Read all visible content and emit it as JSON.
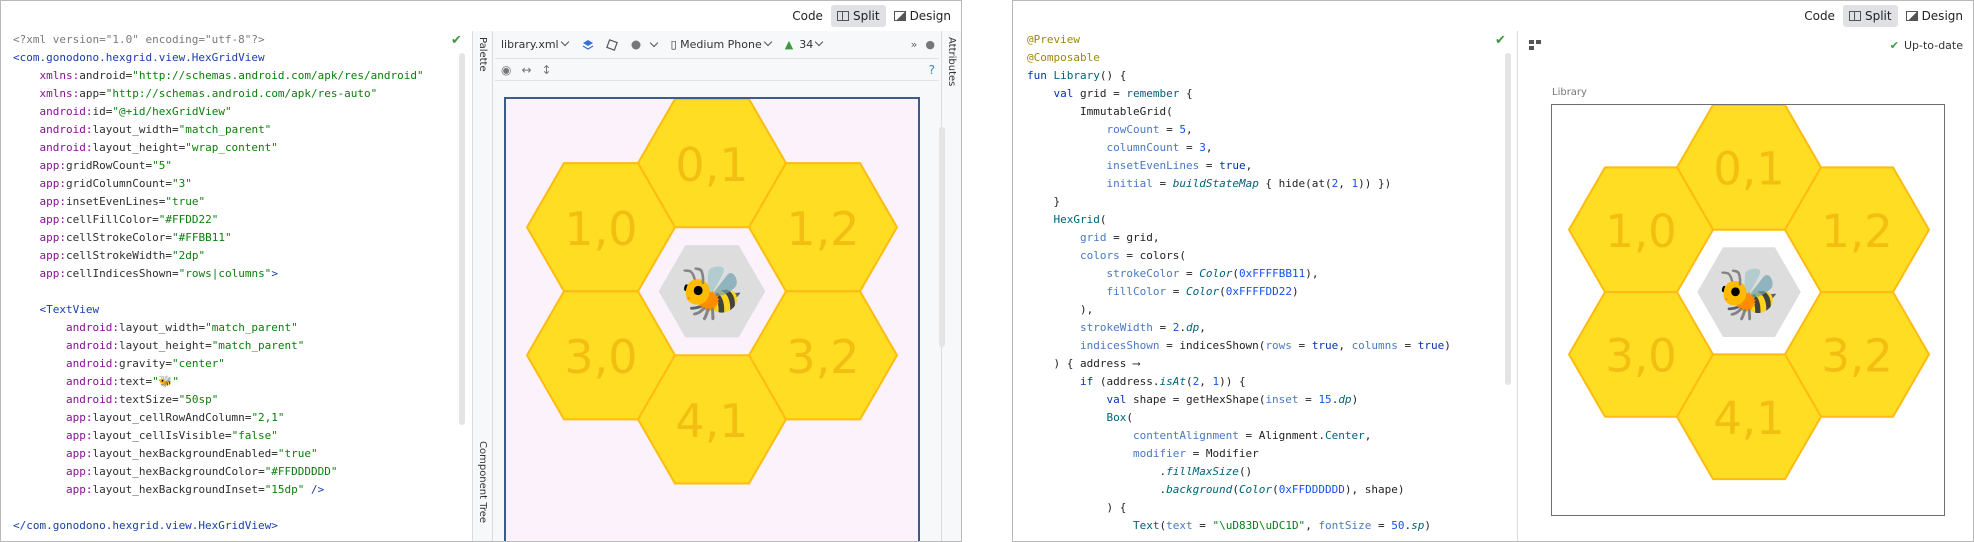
{
  "modes": {
    "code": "Code",
    "split": "Split",
    "design": "Design",
    "active": "Split"
  },
  "xml_lines": [
    [
      [
        "x-dec",
        "<?xml version=\"1.0\" encoding=\"utf-8\"?>"
      ]
    ],
    [
      [
        "x-tag",
        "<com.gonodono.hexgrid.view.HexGridView"
      ]
    ],
    [
      [
        "x-attr",
        "    "
      ],
      [
        "x-ans",
        "xmlns:"
      ],
      [
        "x-attr",
        "android"
      ],
      [
        "x-eq",
        "="
      ],
      [
        "x-val",
        "\"http://schemas.android.com/apk/res/android\""
      ]
    ],
    [
      [
        "x-attr",
        "    "
      ],
      [
        "x-ans",
        "xmlns:"
      ],
      [
        "x-attr",
        "app"
      ],
      [
        "x-eq",
        "="
      ],
      [
        "x-val",
        "\"http://schemas.android.com/apk/res-auto\""
      ]
    ],
    [
      [
        "x-attr",
        "    "
      ],
      [
        "x-ans",
        "android:"
      ],
      [
        "x-attr",
        "id"
      ],
      [
        "x-eq",
        "="
      ],
      [
        "x-val",
        "\"@+id/hexGridView\""
      ]
    ],
    [
      [
        "x-attr",
        "    "
      ],
      [
        "x-ans",
        "android:"
      ],
      [
        "x-attr",
        "layout_width"
      ],
      [
        "x-eq",
        "="
      ],
      [
        "x-val",
        "\"match_parent\""
      ]
    ],
    [
      [
        "x-attr",
        "    "
      ],
      [
        "x-ans",
        "android:"
      ],
      [
        "x-attr",
        "layout_height"
      ],
      [
        "x-eq",
        "="
      ],
      [
        "x-val",
        "\"wrap_content\""
      ]
    ],
    [
      [
        "x-attr",
        "    "
      ],
      [
        "x-ans",
        "app:"
      ],
      [
        "x-attr",
        "gridRowCount"
      ],
      [
        "x-eq",
        "="
      ],
      [
        "x-val",
        "\"5\""
      ]
    ],
    [
      [
        "x-attr",
        "    "
      ],
      [
        "x-ans",
        "app:"
      ],
      [
        "x-attr",
        "gridColumnCount"
      ],
      [
        "x-eq",
        "="
      ],
      [
        "x-val",
        "\"3\""
      ]
    ],
    [
      [
        "x-attr",
        "    "
      ],
      [
        "x-ans",
        "app:"
      ],
      [
        "x-attr",
        "insetEvenLines"
      ],
      [
        "x-eq",
        "="
      ],
      [
        "x-val",
        "\"true\""
      ]
    ],
    [
      [
        "x-attr",
        "    "
      ],
      [
        "x-ans",
        "app:"
      ],
      [
        "x-attr",
        "cellFillColor"
      ],
      [
        "x-eq",
        "="
      ],
      [
        "x-val",
        "\"#FFDD22\""
      ]
    ],
    [
      [
        "x-attr",
        "    "
      ],
      [
        "x-ans",
        "app:"
      ],
      [
        "x-attr",
        "cellStrokeColor"
      ],
      [
        "x-eq",
        "="
      ],
      [
        "x-val",
        "\"#FFBB11\""
      ]
    ],
    [
      [
        "x-attr",
        "    "
      ],
      [
        "x-ans",
        "app:"
      ],
      [
        "x-attr",
        "cellStrokeWidth"
      ],
      [
        "x-eq",
        "="
      ],
      [
        "x-val",
        "\"2dp\""
      ]
    ],
    [
      [
        "x-attr",
        "    "
      ],
      [
        "x-ans",
        "app:"
      ],
      [
        "x-attr",
        "cellIndicesShown"
      ],
      [
        "x-eq",
        "="
      ],
      [
        "x-val",
        "\"rows|columns\""
      ],
      [
        "x-tag",
        ">"
      ]
    ],
    [
      [
        "x-attr",
        " "
      ]
    ],
    [
      [
        "x-attr",
        "    "
      ],
      [
        "x-tag",
        "<TextView"
      ]
    ],
    [
      [
        "x-attr",
        "        "
      ],
      [
        "x-ans",
        "android:"
      ],
      [
        "x-attr",
        "layout_width"
      ],
      [
        "x-eq",
        "="
      ],
      [
        "x-val",
        "\"match_parent\""
      ]
    ],
    [
      [
        "x-attr",
        "        "
      ],
      [
        "x-ans",
        "android:"
      ],
      [
        "x-attr",
        "layout_height"
      ],
      [
        "x-eq",
        "="
      ],
      [
        "x-val",
        "\"match_parent\""
      ]
    ],
    [
      [
        "x-attr",
        "        "
      ],
      [
        "x-ans",
        "android:"
      ],
      [
        "x-attr",
        "gravity"
      ],
      [
        "x-eq",
        "="
      ],
      [
        "x-val",
        "\"center\""
      ]
    ],
    [
      [
        "x-attr",
        "        "
      ],
      [
        "x-ans",
        "android:"
      ],
      [
        "x-attr",
        "text"
      ],
      [
        "x-eq",
        "="
      ],
      [
        "x-val",
        "\"🐝\""
      ]
    ],
    [
      [
        "x-attr",
        "        "
      ],
      [
        "x-ans",
        "android:"
      ],
      [
        "x-attr",
        "textSize"
      ],
      [
        "x-eq",
        "="
      ],
      [
        "x-val",
        "\"50sp\""
      ]
    ],
    [
      [
        "x-attr",
        "        "
      ],
      [
        "x-ans",
        "app:"
      ],
      [
        "x-attr",
        "layout_cellRowAndColumn"
      ],
      [
        "x-eq",
        "="
      ],
      [
        "x-val",
        "\"2,1\""
      ]
    ],
    [
      [
        "x-attr",
        "        "
      ],
      [
        "x-ans",
        "app:"
      ],
      [
        "x-attr",
        "layout_cellIsVisible"
      ],
      [
        "x-eq",
        "="
      ],
      [
        "x-val",
        "\"false\""
      ]
    ],
    [
      [
        "x-attr",
        "        "
      ],
      [
        "x-ans",
        "app:"
      ],
      [
        "x-attr",
        "layout_hexBackgroundEnabled"
      ],
      [
        "x-eq",
        "="
      ],
      [
        "x-val",
        "\"true\""
      ]
    ],
    [
      [
        "x-attr",
        "        "
      ],
      [
        "x-ans",
        "app:"
      ],
      [
        "x-attr",
        "layout_hexBackgroundColor"
      ],
      [
        "x-eq",
        "="
      ],
      [
        "x-val",
        "\"#FFDDDDDD\""
      ]
    ],
    [
      [
        "x-attr",
        "        "
      ],
      [
        "x-ans",
        "app:"
      ],
      [
        "x-attr",
        "layout_hexBackgroundInset"
      ],
      [
        "x-eq",
        "="
      ],
      [
        "x-val",
        "\"15dp\""
      ],
      [
        "x-tag",
        " />"
      ]
    ],
    [
      [
        "x-attr",
        " "
      ]
    ],
    [
      [
        "x-tag",
        "</com.gonodono.hexgrid.view.HexGridView"
      ],
      [
        "x-tag",
        ">"
      ]
    ]
  ],
  "kt_lines": [
    [
      [
        "k-ann",
        "@Preview"
      ]
    ],
    [
      [
        "k-ann",
        "@Composable"
      ]
    ],
    [
      [
        "k-kw",
        "fun "
      ],
      [
        "k-fn",
        "Library"
      ],
      [
        "k-plain",
        "() {"
      ]
    ],
    [
      [
        "k-plain",
        "    "
      ],
      [
        "k-kw",
        "val "
      ],
      [
        "k-id",
        "grid = "
      ],
      [
        "k-fn",
        "remember"
      ],
      [
        "k-plain",
        " {"
      ]
    ],
    [
      [
        "k-plain",
        "        ImmutableGrid("
      ]
    ],
    [
      [
        "k-plain",
        "            "
      ],
      [
        "k-pn",
        "rowCount"
      ],
      [
        "k-plain",
        " = "
      ],
      [
        "k-num",
        "5"
      ],
      [
        "k-plain",
        ","
      ]
    ],
    [
      [
        "k-plain",
        "            "
      ],
      [
        "k-pn",
        "columnCount"
      ],
      [
        "k-plain",
        " = "
      ],
      [
        "k-num",
        "3"
      ],
      [
        "k-plain",
        ","
      ]
    ],
    [
      [
        "k-plain",
        "            "
      ],
      [
        "k-pn",
        "insetEvenLines"
      ],
      [
        "k-plain",
        " = "
      ],
      [
        "k-kw",
        "true"
      ],
      [
        "k-plain",
        ","
      ]
    ],
    [
      [
        "k-plain",
        "            "
      ],
      [
        "k-pn",
        "initial"
      ],
      [
        "k-plain",
        " = "
      ],
      [
        "k-it",
        "buildStateMap"
      ],
      [
        "k-plain",
        " { hide(at("
      ],
      [
        "k-num",
        "2"
      ],
      [
        "k-plain",
        ", "
      ],
      [
        "k-num",
        "1"
      ],
      [
        "k-plain",
        ")) })"
      ]
    ],
    [
      [
        "k-plain",
        "    }"
      ]
    ],
    [
      [
        "k-plain",
        "    "
      ],
      [
        "k-fn",
        "HexGrid"
      ],
      [
        "k-plain",
        "("
      ]
    ],
    [
      [
        "k-plain",
        "        "
      ],
      [
        "k-pn",
        "grid"
      ],
      [
        "k-plain",
        " = grid,"
      ]
    ],
    [
      [
        "k-plain",
        "        "
      ],
      [
        "k-pn",
        "colors"
      ],
      [
        "k-plain",
        " = colors("
      ]
    ],
    [
      [
        "k-plain",
        "            "
      ],
      [
        "k-pn",
        "strokeColor"
      ],
      [
        "k-plain",
        " = "
      ],
      [
        "k-it",
        "Color"
      ],
      [
        "k-plain",
        "("
      ],
      [
        "k-num",
        "0xFFFFBB11"
      ],
      [
        "k-plain",
        "),"
      ]
    ],
    [
      [
        "k-plain",
        "            "
      ],
      [
        "k-pn",
        "fillColor"
      ],
      [
        "k-plain",
        " = "
      ],
      [
        "k-it",
        "Color"
      ],
      [
        "k-plain",
        "("
      ],
      [
        "k-num",
        "0xFFFFDD22"
      ],
      [
        "k-plain",
        ")"
      ]
    ],
    [
      [
        "k-plain",
        "        ),"
      ]
    ],
    [
      [
        "k-plain",
        "        "
      ],
      [
        "k-pn",
        "strokeWidth"
      ],
      [
        "k-plain",
        " = "
      ],
      [
        "k-num",
        "2"
      ],
      [
        "k-plain",
        "."
      ],
      [
        "k-it",
        "dp"
      ],
      [
        "k-plain",
        ","
      ]
    ],
    [
      [
        "k-plain",
        "        "
      ],
      [
        "k-pn",
        "indicesShown"
      ],
      [
        "k-plain",
        " = indicesShown("
      ],
      [
        "k-pn",
        "rows"
      ],
      [
        "k-plain",
        " = "
      ],
      [
        "k-kw",
        "true"
      ],
      [
        "k-plain",
        ", "
      ],
      [
        "k-pn",
        "columns"
      ],
      [
        "k-plain",
        " = "
      ],
      [
        "k-kw",
        "true"
      ],
      [
        "k-plain",
        ")"
      ]
    ],
    [
      [
        "k-plain",
        "    ) { address ⟶"
      ]
    ],
    [
      [
        "k-plain",
        "        "
      ],
      [
        "k-kw",
        "if"
      ],
      [
        "k-plain",
        " (address."
      ],
      [
        "k-it",
        "isAt"
      ],
      [
        "k-plain",
        "("
      ],
      [
        "k-num",
        "2"
      ],
      [
        "k-plain",
        ", "
      ],
      [
        "k-num",
        "1"
      ],
      [
        "k-plain",
        ")) {"
      ]
    ],
    [
      [
        "k-plain",
        "            "
      ],
      [
        "k-kw",
        "val "
      ],
      [
        "k-plain",
        "shape = getHexShape("
      ],
      [
        "k-pn",
        "inset"
      ],
      [
        "k-plain",
        " = "
      ],
      [
        "k-num",
        "15"
      ],
      [
        "k-plain",
        "."
      ],
      [
        "k-it",
        "dp"
      ],
      [
        "k-plain",
        ")"
      ]
    ],
    [
      [
        "k-plain",
        "            "
      ],
      [
        "k-fn",
        "Box"
      ],
      [
        "k-plain",
        "("
      ]
    ],
    [
      [
        "k-plain",
        "                "
      ],
      [
        "k-pn",
        "contentAlignment"
      ],
      [
        "k-plain",
        " = Alignment."
      ],
      [
        "k-fn",
        "Center"
      ],
      [
        "k-plain",
        ","
      ]
    ],
    [
      [
        "k-plain",
        "                "
      ],
      [
        "k-pn",
        "modifier"
      ],
      [
        "k-plain",
        " = Modifier"
      ]
    ],
    [
      [
        "k-plain",
        "                    ."
      ],
      [
        "k-it",
        "fillMaxSize"
      ],
      [
        "k-plain",
        "()"
      ]
    ],
    [
      [
        "k-plain",
        "                    ."
      ],
      [
        "k-it",
        "background"
      ],
      [
        "k-plain",
        "("
      ],
      [
        "k-it",
        "Color"
      ],
      [
        "k-plain",
        "("
      ],
      [
        "k-num",
        "0xFFDDDDDD"
      ],
      [
        "k-plain",
        "), shape)"
      ]
    ],
    [
      [
        "k-plain",
        "            ) {"
      ]
    ],
    [
      [
        "k-plain",
        "                "
      ],
      [
        "k-fn",
        "Text"
      ],
      [
        "k-plain",
        "("
      ],
      [
        "k-pn",
        "text"
      ],
      [
        "k-plain",
        " = "
      ],
      [
        "k-str",
        "\"\\uD83D\\uDC1D\""
      ],
      [
        "k-plain",
        ", "
      ],
      [
        "k-pn",
        "fontSize"
      ],
      [
        "k-plain",
        " = "
      ],
      [
        "k-num",
        "50"
      ],
      [
        "k-plain",
        "."
      ],
      [
        "k-it",
        "sp"
      ],
      [
        "k-plain",
        ")"
      ]
    ]
  ],
  "design_toolbar": {
    "file": "library.xml",
    "device": "Medium Phone",
    "api": "34",
    "palette": "Palette",
    "component_tree": "Component Tree",
    "attributes": "Attributes"
  },
  "preview": {
    "status": "Up-to-date",
    "label": "Library"
  },
  "grid": {
    "cells": [
      "0,1",
      "1,0",
      "1,2",
      "3,0",
      "3,2",
      "4,1"
    ],
    "hidden_cell": "2,1",
    "center_emoji": "🐝",
    "fill_color": "#FFDD22",
    "stroke_color": "#FFBB11",
    "label_color": "#F3BE12",
    "inset_bg_color": "#DDDDDD"
  }
}
